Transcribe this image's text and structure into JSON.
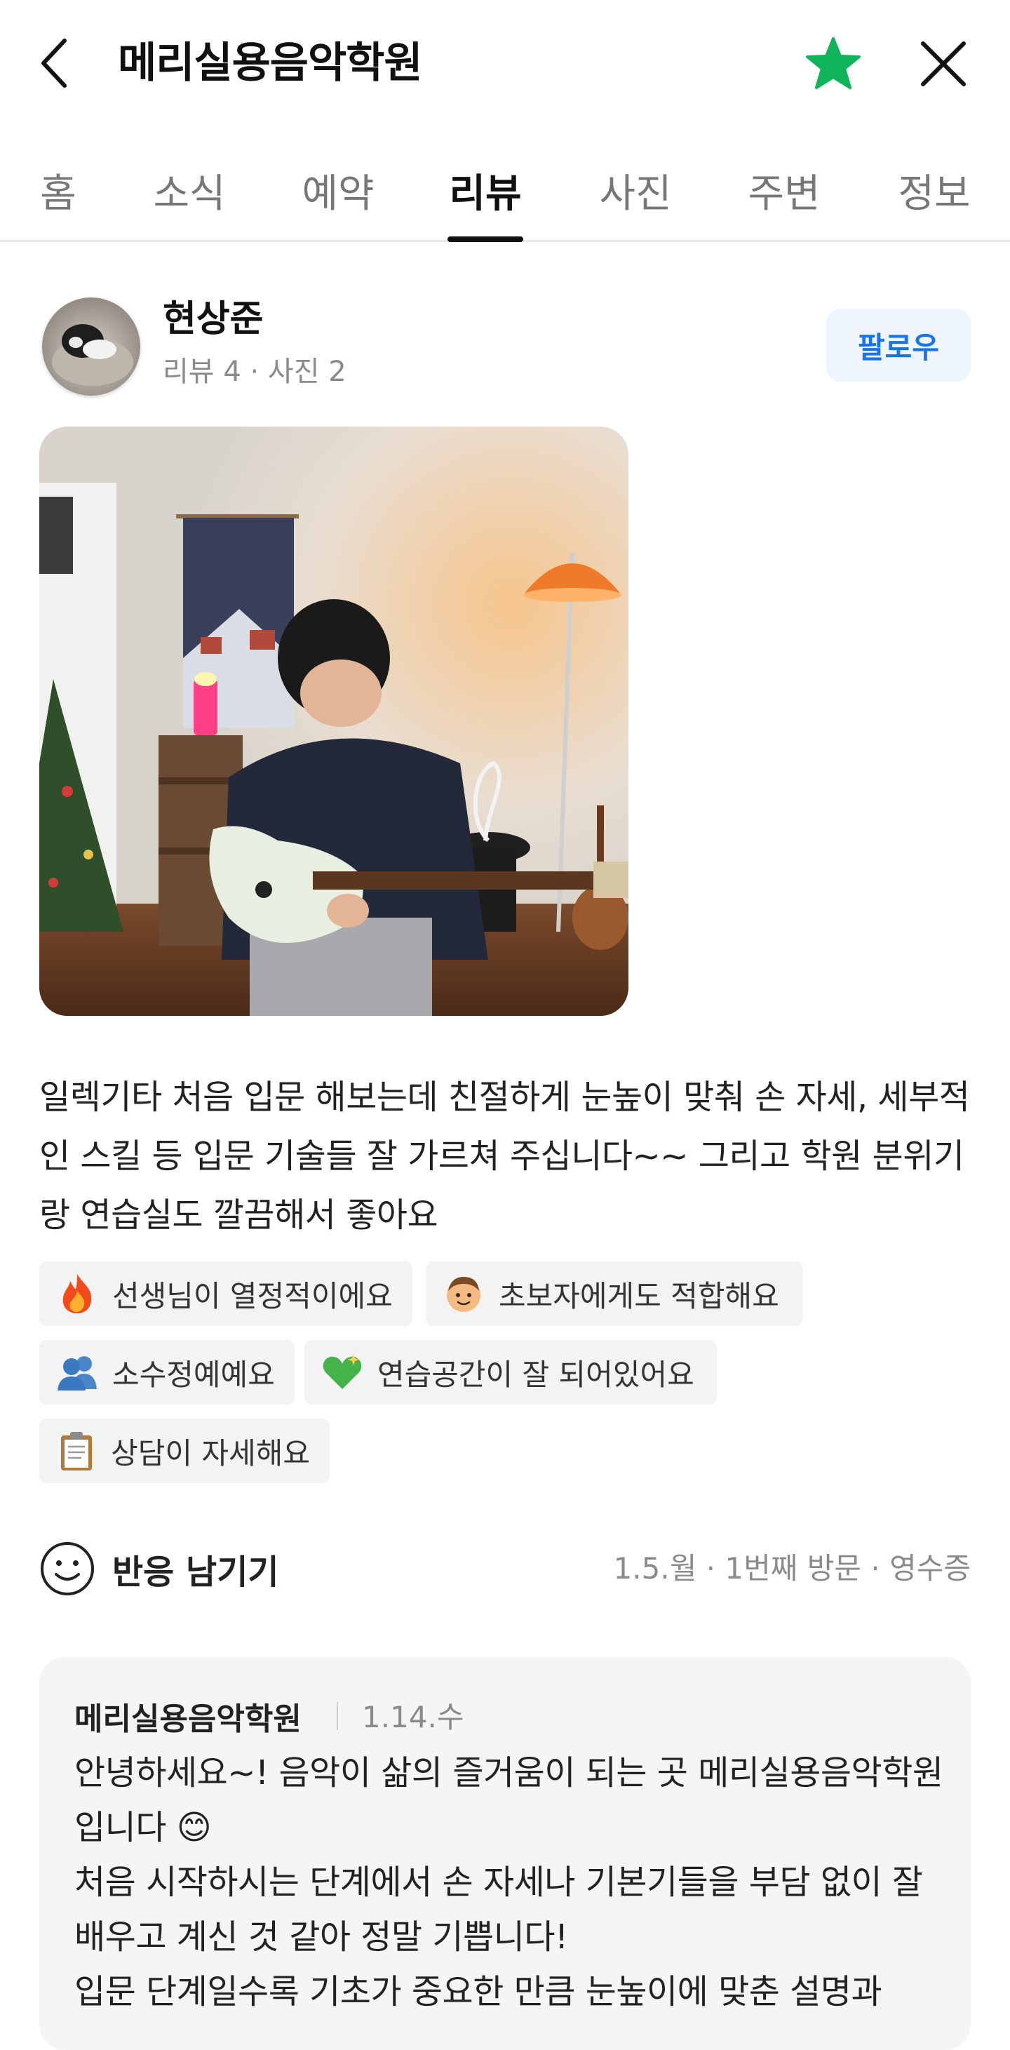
{
  "header": {
    "title": "메리실용음악학원",
    "back_icon": "chevron-left-icon",
    "favorite_icon": "star-icon",
    "close_icon": "close-icon",
    "accent_color": "#0fb35a"
  },
  "tabs": [
    {
      "label": "홈"
    },
    {
      "label": "소식"
    },
    {
      "label": "예약"
    },
    {
      "label": "리뷰",
      "active": true
    },
    {
      "label": "사진"
    },
    {
      "label": "주변"
    },
    {
      "label": "정보"
    }
  ],
  "reviewer": {
    "name": "현상준",
    "stats": "리뷰 4 · 사진 2",
    "follow_label": "팔로우"
  },
  "review": {
    "text": "일렉기타 처음 입문 해보는데 친절하게 눈높이 맞춰 손 자세, 세부적인 스킬 등 입문 기술들 잘 가르쳐 주십니다~~ 그리고 학원 분위기랑 연습실도 깔끔해서 좋아요",
    "tags": [
      {
        "label": "선생님이 열정적이에요",
        "icon": "fire-icon"
      },
      {
        "label": "초보자에게도 적합해요",
        "icon": "child-face-icon"
      },
      {
        "label": "소수정예예요",
        "icon": "people-icon"
      },
      {
        "label": "연습공간이 잘 되어있어요",
        "icon": "sparkling-heart-icon"
      },
      {
        "label": "상담이 자세해요",
        "icon": "clipboard-icon"
      }
    ],
    "reaction_label": "반응 남기기",
    "visit_meta": "1.5.월 · 1번째 방문 · 영수증"
  },
  "reply": {
    "owner": "메리실용음악학원",
    "date": "1.14.수",
    "text": "안녕하세요~! 음악이 삶의 즐거움이 되는 곳 메리실용음악학원입니다 😊\n처음 시작하시는 단계에서 손 자세나 기본기들을 부담 없이 잘 배우고 계신 것 같아 정말 기쁩니다!\n입문 단계일수록 기초가 중요한 만큼 눈높이에 맞춘 설명과"
  }
}
